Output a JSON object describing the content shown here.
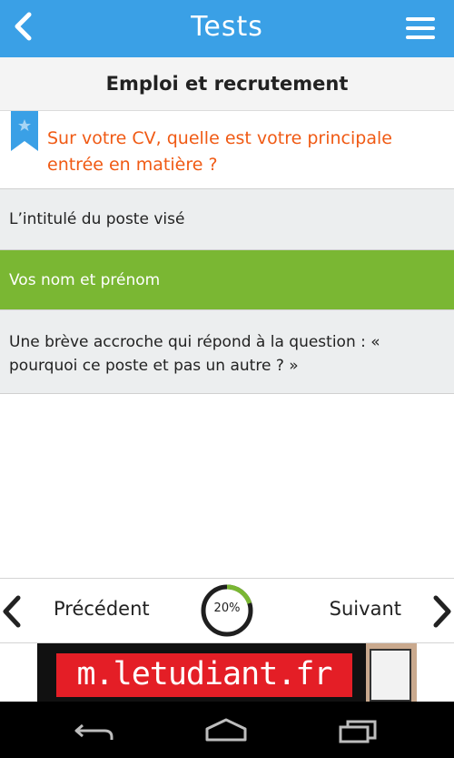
{
  "header": {
    "title": "Tests",
    "back_icon": "chevron-left-icon",
    "menu_icon": "hamburger-menu-icon",
    "background": "#3aa0e6"
  },
  "category": {
    "label": "Emploi et recrutement"
  },
  "question": {
    "text": "Sur votre CV, quelle est votre principale entrée en matière ?",
    "icon": "bookmark-icon",
    "color": "#f05a14"
  },
  "answers": [
    {
      "label": "L’intitulé du poste visé",
      "selected": false
    },
    {
      "label": "Vos nom et prénom",
      "selected": true
    },
    {
      "label": "Une brève accroche qui répond à la question : « pourquoi ce poste et pas un autre ? »",
      "selected": false
    }
  ],
  "colors": {
    "selected": "#7ab733",
    "answer_bg": "#eceeef",
    "progress_fill": "#7ab733"
  },
  "navigation": {
    "previous_label": "Précédent",
    "next_label": "Suivant",
    "progress_text": "20%",
    "progress_fraction": 0.2
  },
  "ad": {
    "text": "m.letudiant.fr"
  },
  "system_nav": {
    "back_icon": "system-back-icon",
    "home_icon": "system-home-icon",
    "recents_icon": "system-recents-icon"
  }
}
